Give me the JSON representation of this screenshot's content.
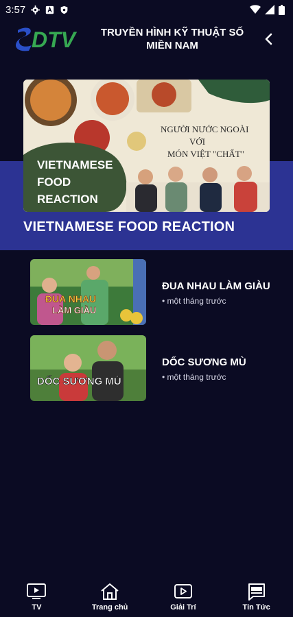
{
  "status_bar": {
    "time": "3:57",
    "icons": [
      "settings-icon",
      "a-badge-icon",
      "shield-icon",
      "wifi-icon",
      "signal-icon",
      "battery-icon"
    ]
  },
  "header": {
    "logo_text": "SDTV",
    "title": "TRUYỀN HÌNH KỸ THUẬT SỐ MIỀN NAM",
    "back_icon": "chevron-left-icon"
  },
  "featured": {
    "image_text_left": [
      "VIETNAMESE",
      "FOOD",
      "REACTION"
    ],
    "image_text_right": [
      "NGƯỜI NƯỚC NGOÀI",
      "VỚI",
      "MÓN VIỆT \"CHẤT\""
    ],
    "title": "VIETNAMESE FOOD REACTION",
    "band_color": "#2c3393"
  },
  "list": [
    {
      "title": "ĐUA NHAU LÀM GIÀU",
      "meta": "• một tháng trước",
      "thumb_text": [
        "ĐUA NHAU",
        "LÀM GIÀU"
      ]
    },
    {
      "title": "DỐC SƯƠNG MÙ",
      "meta": "• một tháng trước",
      "thumb_text": [
        "DỐC SƯƠNG MÙ"
      ]
    }
  ],
  "bottom_nav": [
    {
      "label": "TV",
      "icon": "tv-play-icon"
    },
    {
      "label": "Trang chủ",
      "icon": "home-icon"
    },
    {
      "label": "Giải Trí",
      "icon": "play-icon"
    },
    {
      "label": "Tin Tức",
      "icon": "news-icon"
    }
  ],
  "colors": {
    "background": "#0b0b23",
    "logo_blue": "#2a4fc8",
    "logo_green": "#36a852"
  }
}
